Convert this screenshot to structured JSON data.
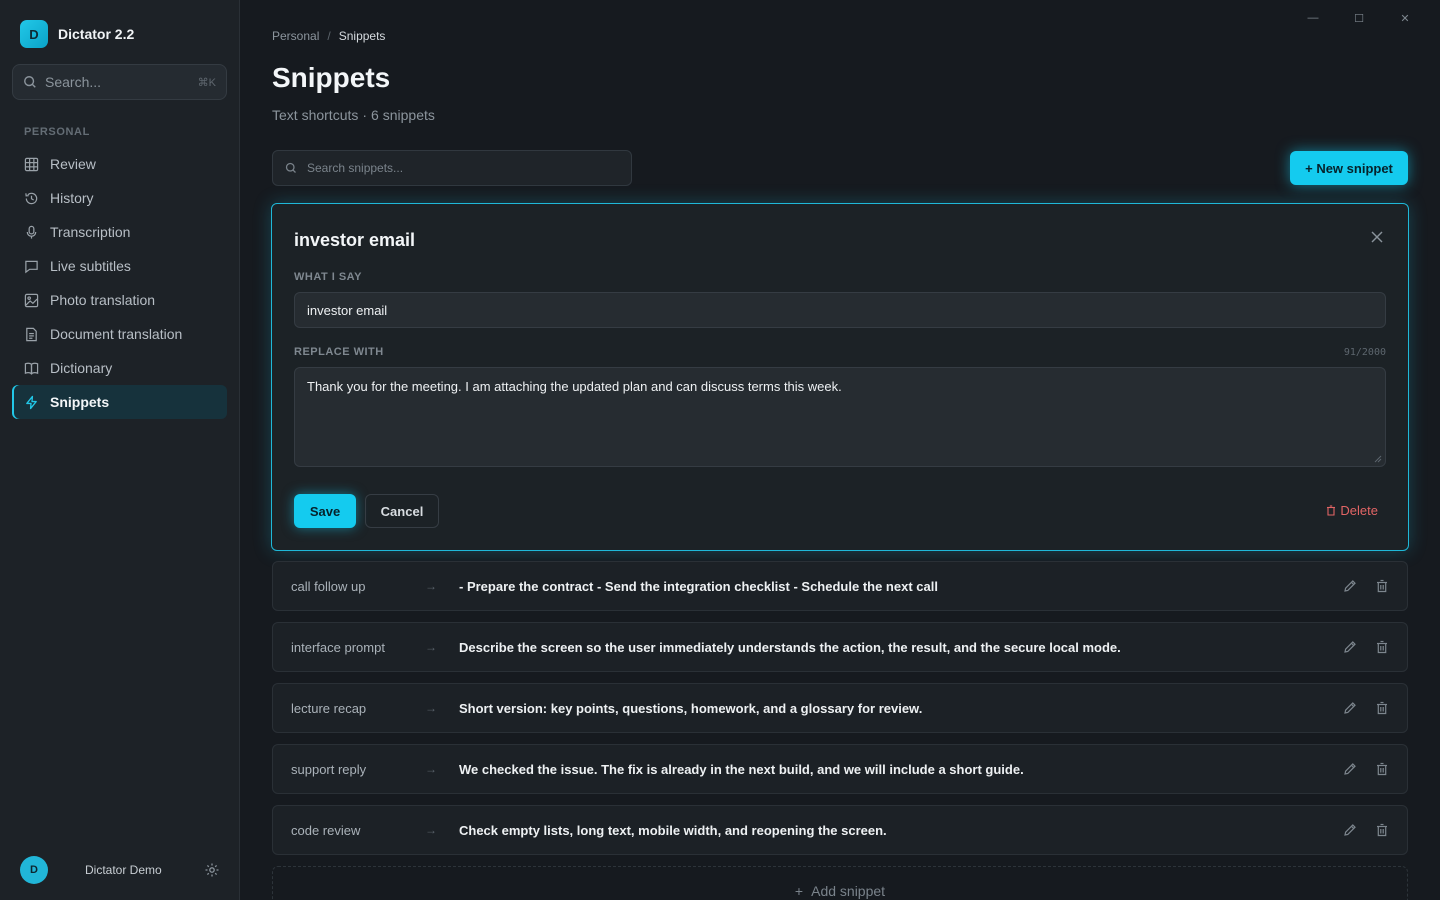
{
  "app": {
    "logo_letter": "D",
    "name": "Dictator 2.2"
  },
  "sidebar": {
    "search_placeholder": "Search...",
    "search_shortcut": "⌘K",
    "section_label": "PERSONAL",
    "items": [
      {
        "label": "Review",
        "icon": "grid-icon"
      },
      {
        "label": "History",
        "icon": "history-icon"
      },
      {
        "label": "Transcription",
        "icon": "microphone-icon"
      },
      {
        "label": "Live subtitles",
        "icon": "speech-bubble-icon"
      },
      {
        "label": "Photo translation",
        "icon": "image-icon"
      },
      {
        "label": "Document translation",
        "icon": "document-icon"
      },
      {
        "label": "Dictionary",
        "icon": "book-icon"
      },
      {
        "label": "Snippets",
        "icon": "lightning-icon",
        "active": true
      }
    ],
    "user": {
      "initial": "D",
      "name": "Dictator Demo"
    }
  },
  "window_controls": {
    "minimize": "—",
    "maximize": "☐",
    "close": "✕"
  },
  "breadcrumb": {
    "parent": "Personal",
    "separator": "/",
    "current": "Snippets"
  },
  "page": {
    "title": "Snippets",
    "subtitle_part1": "Text shortcuts",
    "subtitle_dot": "·",
    "subtitle_part2": "6 snippets"
  },
  "toolbar": {
    "search_placeholder": "Search snippets...",
    "new_button_label": "+ New snippet"
  },
  "editor": {
    "title": "investor email",
    "what_i_say_label": "WHAT I SAY",
    "what_i_say_value": "investor email",
    "replace_with_label": "REPLACE WITH",
    "char_count": "91/2000",
    "replace_with_value": "Thank you for the meeting. I am attaching the updated plan and can discuss terms this week.",
    "save_label": "Save",
    "cancel_label": "Cancel",
    "delete_label": "Delete"
  },
  "snippets": [
    {
      "trigger": "call follow up",
      "arrow": "→",
      "text": "- Prepare the contract - Send the integration checklist - Schedule the next call"
    },
    {
      "trigger": "interface prompt",
      "arrow": "→",
      "text": "Describe the screen so the user immediately understands the action, the result, and the secure local mode."
    },
    {
      "trigger": "lecture recap",
      "arrow": "→",
      "text": "Short version: key points, questions, homework, and a glossary for review."
    },
    {
      "trigger": "support reply",
      "arrow": "→",
      "text": "We checked the issue. The fix is already in the next build, and we will include a short guide."
    },
    {
      "trigger": "code review",
      "arrow": "→",
      "text": "Check empty lists, long text, mobile width, and reopening the screen."
    }
  ],
  "add_snippet_label": "Add snippet",
  "add_snippet_icon": "+",
  "colors": {
    "accent": "#14cbef",
    "danger": "#e26565",
    "background": "#161a1f",
    "sidebar": "#1d2227"
  }
}
